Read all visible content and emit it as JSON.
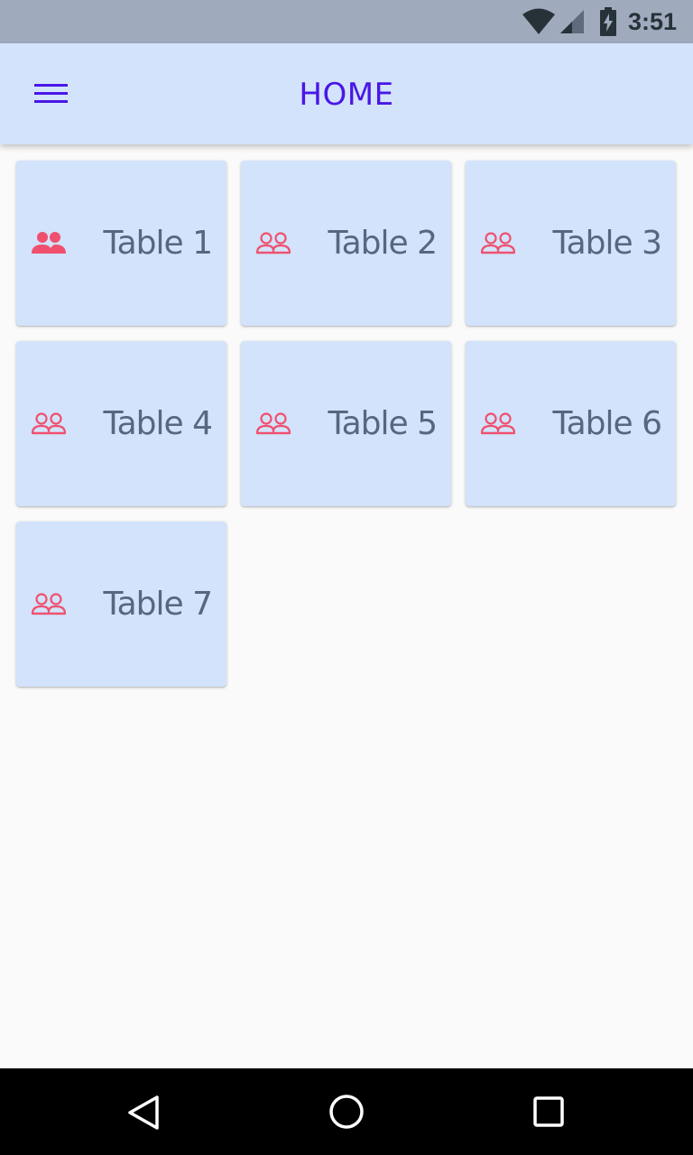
{
  "status_bar": {
    "time": "3:51",
    "icons": [
      "wifi-icon",
      "cell-signal-icon",
      "battery-charging-icon"
    ]
  },
  "app_bar": {
    "title": "HOME",
    "menu_icon": "hamburger-menu-icon",
    "background": "#d2e3fb",
    "title_color": "#4a16e6"
  },
  "tables": [
    {
      "label": "Table 1",
      "icon": "people-filled-icon",
      "selected": true
    },
    {
      "label": "Table 2",
      "icon": "people-outline-icon",
      "selected": false
    },
    {
      "label": "Table 3",
      "icon": "people-outline-icon",
      "selected": false
    },
    {
      "label": "Table 4",
      "icon": "people-outline-icon",
      "selected": false
    },
    {
      "label": "Table 5",
      "icon": "people-outline-icon",
      "selected": false
    },
    {
      "label": "Table 6",
      "icon": "people-outline-icon",
      "selected": false
    },
    {
      "label": "Table 7",
      "icon": "people-outline-icon",
      "selected": false
    }
  ],
  "colors": {
    "card_background": "#d2e3fb",
    "card_text": "#58667e",
    "icon_color": "#f0506e",
    "page_background": "#fafafa"
  },
  "nav_bar": {
    "icons": [
      "back-icon",
      "home-icon",
      "recents-icon"
    ]
  }
}
